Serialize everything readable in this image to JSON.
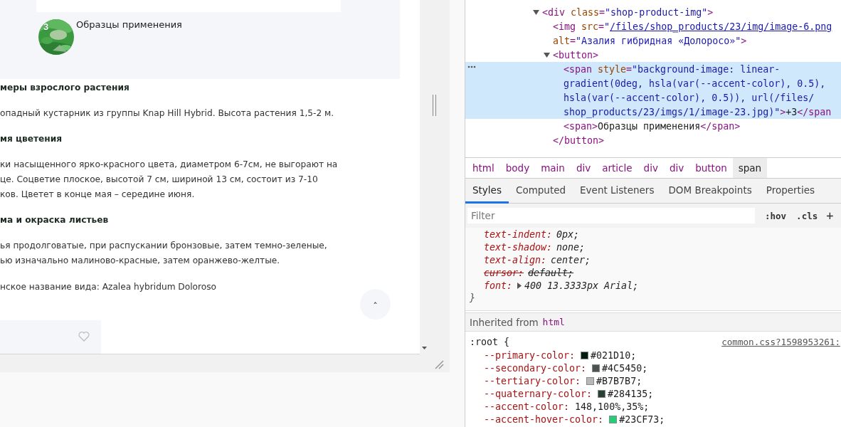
{
  "page": {
    "gallery_button": {
      "badge": "3",
      "label": "Образцы применения"
    },
    "sections": [
      {
        "heading": "меры взрослого растения",
        "lines": [
          "опадный кустарник из группы Knap Hill Hybrid. Высота растения 1,5-2 м."
        ]
      },
      {
        "heading": "мя цветения",
        "lines": [
          "ки насыщенного ярко-красного цвета, диаметром 6-7см, не выгорают на",
          "це. Соцветие плоское, высотой 7 см, шириной 13 см, состоит из 7-10",
          "ков. Цветет в конце мая – середине июня."
        ]
      },
      {
        "heading": "ма и окраска листьев",
        "lines": [
          "ья продолговатые, при распускании бронзовые, затем темно-зеленые,",
          "ью изначально малиново-красные, затем оранжево-желтые."
        ]
      },
      {
        "lines": [
          "нское название вида: Azalea hybridum Doloroso"
        ]
      }
    ],
    "scroll_top_button": {
      "label": "ˆ"
    },
    "favorite": {
      "selected": false
    }
  },
  "devtools": {
    "dom_tree": [
      {
        "expanded": true,
        "lines": [
          [
            {
              "kind": "tag",
              "text": "<div"
            },
            {
              "kind": "attr",
              "text": " class"
            },
            {
              "kind": "tag",
              "text": "="
            },
            {
              "kind": "value",
              "text": "\"shop-product-img\""
            },
            {
              "kind": "tag",
              "text": ">"
            }
          ]
        ],
        "children": [
          {
            "lines": [
              [
                {
                  "kind": "tag",
                  "text": "<img"
                },
                {
                  "kind": "attr",
                  "text": " src"
                },
                {
                  "kind": "tag",
                  "text": "="
                },
                {
                  "kind": "value",
                  "text": "\""
                },
                {
                  "kind": "link",
                  "text": "/files/shop_products/23/img/image-6.png"
                }
              ],
              [
                {
                  "kind": "attr",
                  "text": "alt"
                },
                {
                  "kind": "tag",
                  "text": "="
                },
                {
                  "kind": "value",
                  "text": "\"Азалия гибридная «Долоросо»\""
                },
                {
                  "kind": "tag",
                  "text": ">"
                }
              ]
            ]
          },
          {
            "expanded": true,
            "lines": [
              [
                {
                  "kind": "tag",
                  "text": "<button>"
                }
              ]
            ],
            "children": [
              {
                "selected": true,
                "lines": [
                  [
                    {
                      "kind": "tag",
                      "text": "<span"
                    },
                    {
                      "kind": "attr",
                      "text": " style"
                    },
                    {
                      "kind": "tag",
                      "text": "="
                    },
                    {
                      "kind": "value",
                      "text": "\"background-image: linear-"
                    }
                  ],
                  [
                    {
                      "kind": "value",
                      "text": "gradient(0deg, hsla(var(--accent-color), 0.5),"
                    }
                  ],
                  [
                    {
                      "kind": "value",
                      "text": "hsla(var(--accent-color), 0.5)), url(/files/"
                    }
                  ],
                  [
                    {
                      "kind": "value",
                      "text": "shop_products/23/imgs/1/image-23.jpg)\""
                    },
                    {
                      "kind": "tag",
                      "text": ">"
                    },
                    {
                      "kind": "text",
                      "text": "+3"
                    },
                    {
                      "kind": "tag",
                      "text": "</span"
                    }
                  ]
                ]
              },
              {
                "selected": false,
                "lines": [
                  [
                    {
                      "kind": "tag",
                      "text": "<span>"
                    },
                    {
                      "kind": "text",
                      "text": "Образцы применения"
                    },
                    {
                      "kind": "tag",
                      "text": "</span>"
                    }
                  ]
                ]
              }
            ],
            "closing": [
              {
                "kind": "tag",
                "text": "</button>"
              }
            ]
          }
        ]
      }
    ],
    "breadcrumbs": [
      {
        "label": "html",
        "selected": false
      },
      {
        "label": "body",
        "selected": false
      },
      {
        "label": "main",
        "selected": false
      },
      {
        "label": "div",
        "selected": false
      },
      {
        "label": "article",
        "selected": false
      },
      {
        "label": "div",
        "selected": false
      },
      {
        "label": "div",
        "selected": false
      },
      {
        "label": "button",
        "selected": false
      },
      {
        "label": "span",
        "selected": true
      }
    ],
    "tabs": [
      {
        "label": "Styles",
        "selected": true
      },
      {
        "label": "Computed",
        "selected": false
      },
      {
        "label": "Event Listeners",
        "selected": false
      },
      {
        "label": "DOM Breakpoints",
        "selected": false
      },
      {
        "label": "Properties",
        "selected": false
      }
    ],
    "filter": {
      "placeholder": "Filter"
    },
    "filter_buttons": [
      ":hov",
      ".cls",
      "+"
    ],
    "rules": [
      {
        "declarations": [
          {
            "name": "text-indent:",
            "value": "0px;",
            "struck": false
          },
          {
            "name": "text-shadow:",
            "value": "none;",
            "struck": false
          },
          {
            "name": "text-align:",
            "value": "center;",
            "struck": false
          },
          {
            "name": "cursor:",
            "value": "default;",
            "struck": true
          },
          {
            "name": "font:",
            "value": "400 13.3333px Arial;",
            "struck": false,
            "expandable": true
          }
        ],
        "closing": "}"
      },
      {
        "inherited_label": "Inherited from",
        "inherited_from": "html",
        "selector": ":root {",
        "source": "common.css?1598953261:",
        "declarations": [
          {
            "name": "--primary-color:",
            "value": "#021D10;",
            "color": "#021d10",
            "struck": false
          },
          {
            "name": "--secondary-color:",
            "value": "#4C5450;",
            "color": "#4c5450",
            "struck": false
          },
          {
            "name": "--tertiary-color:",
            "value": "#B7B7B7;",
            "color": "#b7b7b7",
            "struck": false
          },
          {
            "name": "--quaternary-color:",
            "value": "#284135;",
            "color": "#284135",
            "struck": false
          },
          {
            "name": "--accent-color:",
            "value": "148,100%,35%;",
            "struck": false
          },
          {
            "name": "--accent-hover-color:",
            "value": "#23CF73;",
            "color": "#23cf73",
            "struck": false
          }
        ]
      }
    ]
  }
}
